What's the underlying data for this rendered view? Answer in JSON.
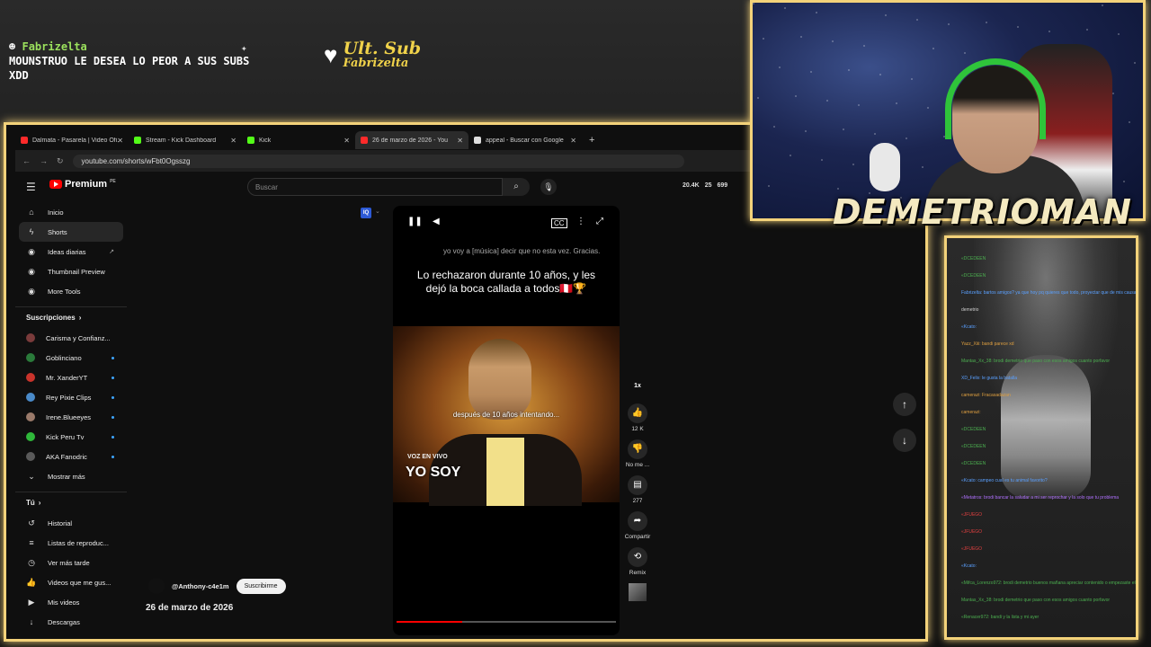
{
  "alert": {
    "username": "Fabrizelta",
    "message": "MOUNSTRUO LE DESEA LO PEOR A SUS SUBS XDD"
  },
  "badge": {
    "title": "Ult. Sub",
    "name": "Fabrizelta"
  },
  "browser": {
    "tabs": [
      {
        "title": "Dalmata - Pasarela | Video Ofi...",
        "color": "#ff2a2a",
        "active": false
      },
      {
        "title": "Stream - Kick Dashboard",
        "color": "#53fc18",
        "active": false
      },
      {
        "title": "Kick",
        "color": "#53fc18",
        "active": false
      },
      {
        "title": "26 de marzo de 2026 - You",
        "color": "#ff2a2a",
        "active": true
      },
      {
        "title": "appeal - Buscar con Google",
        "color": "#dddddd",
        "active": false
      }
    ],
    "url": "youtube.com/shorts/wFbt0Ogsszg"
  },
  "youtube": {
    "logo": "Premium",
    "search_placeholder": "Buscar",
    "stats": [
      "20.4K",
      "25",
      "699"
    ],
    "nav": [
      {
        "label": "Inicio",
        "icon": "home-icon"
      },
      {
        "label": "Shorts",
        "icon": "shorts-icon",
        "selected": true
      },
      {
        "label": "Ideas diarias",
        "icon": "extension-icon"
      },
      {
        "label": "Thumbnail Preview",
        "icon": "extension-icon"
      },
      {
        "label": "More Tools",
        "icon": "extension-icon"
      }
    ],
    "subs_heading": "Suscripciones",
    "subscriptions": [
      {
        "label": "Carisma y Confianz...",
        "color": "#7a3b3b",
        "dot": false
      },
      {
        "label": "Goblinciano",
        "color": "#2a7a3a",
        "dot": true
      },
      {
        "label": "Mr. XanderYT",
        "color": "#c9332b",
        "dot": true
      },
      {
        "label": "Rey Pixie Clips",
        "color": "#4a8ac9",
        "dot": true
      },
      {
        "label": "Irene.Blueeyes",
        "color": "#9a7a6a",
        "dot": true
      },
      {
        "label": "Kick Peru Tv",
        "color": "#2fb83a",
        "dot": true
      },
      {
        "label": "AKA Fanodric",
        "color": "#5a5a5a",
        "dot": true
      }
    ],
    "show_more": "Mostrar más",
    "you_heading": "Tú",
    "you_items": [
      {
        "label": "Historial",
        "icon": "history-icon"
      },
      {
        "label": "Listas de reproduc...",
        "icon": "playlist-icon"
      },
      {
        "label": "Ver más tarde",
        "icon": "clock-icon"
      },
      {
        "label": "Videos que me gus...",
        "icon": "like-icon"
      },
      {
        "label": "Mis videos",
        "icon": "video-icon"
      },
      {
        "label": "Descargas",
        "icon": "download-icon"
      }
    ],
    "video": {
      "caption_small": "yo voy a [música] decir que no esta vez. Gracias.",
      "caption_main": "Lo rechazaron durante 10 años, y les dejó la boca callada a todos🇵🇪🏆",
      "overlay_text": "después de 10 años intentando...",
      "watermark_top": "VOZ EN VIVO",
      "watermark_brand": "YO SOY",
      "progress": 0.3
    },
    "actions": {
      "speed": "1x",
      "likes": "12 K",
      "dislike": "No me ...",
      "comments": "277",
      "share": "Compartir",
      "remix": "Remix"
    },
    "channel": {
      "handle": "@Anthony-c4e1m",
      "subscribe": "Suscribirme"
    },
    "publish_date": "26 de marzo de 2026"
  },
  "streamer": {
    "name": "DEMETRIOMAN"
  },
  "chat": {
    "lines": [
      {
        "user": "«DCEDEEN",
        "color": "#4caf50"
      },
      {
        "user": "«DCEDEEN",
        "color": "#4caf50"
      },
      {
        "user": "Fabrizelta: bartos amigos? ya que hoy pq quieres que todo, proyectar que de mis causas de la enfermedad",
        "color": "#5aa0ff"
      },
      {
        "user": "demetrio",
        "color": "#cfcfcf"
      },
      {
        "user": "«Kcato:",
        "color": "#5aa0ff"
      },
      {
        "user": "Yazz_Xiii: bandi parece xd",
        "color": "#e0a040"
      },
      {
        "user": "Mantas_Xx_38: brodi demetrio que paso con esos amigos cuanto porfavor",
        "color": "#4caf50"
      },
      {
        "user": "XD_Felix: le gusta la batalla",
        "color": "#5aa0ff"
      },
      {
        "user": "camerazi: Fracasadazan",
        "color": "#e0a040"
      },
      {
        "user": "camerazi:",
        "color": "#e0a040"
      },
      {
        "user": "«DCEDEEN",
        "color": "#4caf50"
      },
      {
        "user": "«DCEDEEN",
        "color": "#4caf50"
      },
      {
        "user": "«DCEDEEN",
        "color": "#4caf50"
      },
      {
        "user": "«Kcato: campeo cual es tu animal favorito?",
        "color": "#5aa0ff"
      },
      {
        "user": "«Metatros: brodi bancar la saludar a mi ser reprochar y la solo que tu problema",
        "color": "#b070ff"
      },
      {
        "user": "«JFUEGO",
        "color": "#e04040"
      },
      {
        "user": "«JFUEGO",
        "color": "#e04040"
      },
      {
        "user": "«JFUEGO",
        "color": "#e04040"
      },
      {
        "user": "«Kcato:",
        "color": "#5aa0ff"
      },
      {
        "user": "«Mifca_Lorenzo972: brodi demetrio buenos mañana apreciar contenido o empezaste el perdí mi apuesta xd?",
        "color": "#4caf50"
      },
      {
        "user": "Mantas_Xx_38: brodi demetrio que paso con esos amigos cuanto porfavor",
        "color": "#4caf50"
      },
      {
        "user": "«Renacer972: bandi y la lista y mi ayer",
        "color": "#4caf50"
      }
    ]
  }
}
